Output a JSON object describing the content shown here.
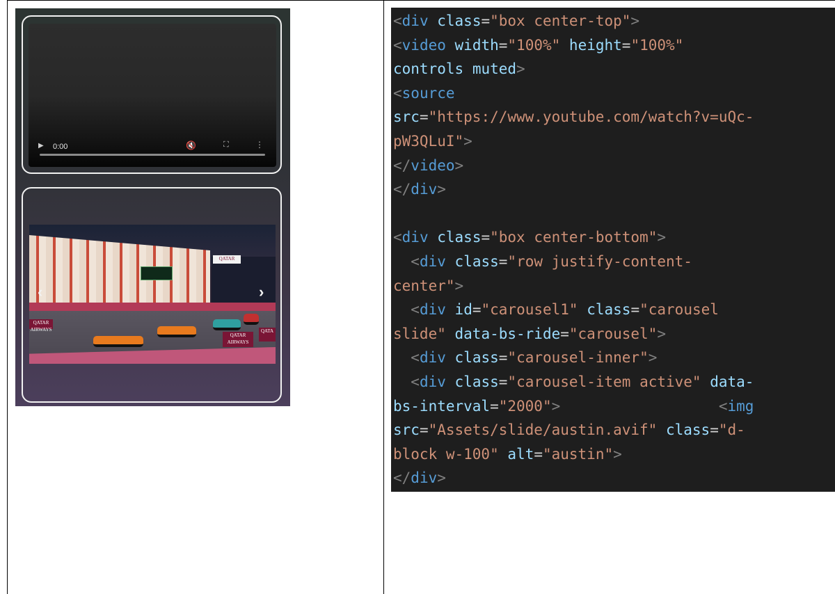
{
  "video_player": {
    "time": "0:00",
    "progress": 0,
    "icons": [
      "play-icon",
      "mute-icon",
      "fullscreen-icon",
      "more-options-icon"
    ]
  },
  "carousel": {
    "image_alt": "austin",
    "ad_texts": [
      "QATAR",
      "QATAR AIRWAYS",
      "QATAR AIRWAYS",
      "QATA"
    ],
    "prev_icon": "chevron-left-icon",
    "next_icon": "chevron-right-icon"
  },
  "code_lines": [
    [
      [
        "p",
        "<"
      ],
      [
        "t",
        "div"
      ],
      [
        "x",
        " "
      ],
      [
        "a",
        "class"
      ],
      [
        "x",
        "="
      ],
      [
        "s",
        "\"box center-top\""
      ],
      [
        "p",
        ">"
      ]
    ],
    [
      [
        "p",
        "<"
      ],
      [
        "t",
        "video"
      ],
      [
        "x",
        " "
      ],
      [
        "a",
        "width"
      ],
      [
        "x",
        "="
      ],
      [
        "s",
        "\"100%\""
      ],
      [
        "x",
        " "
      ],
      [
        "a",
        "height"
      ],
      [
        "x",
        "="
      ],
      [
        "s",
        "\"100%\""
      ]
    ],
    [
      [
        "a",
        "controls"
      ],
      [
        "x",
        " "
      ],
      [
        "a",
        "muted"
      ],
      [
        "p",
        ">"
      ]
    ],
    [
      [
        "p",
        "<"
      ],
      [
        "t",
        "source"
      ]
    ],
    [
      [
        "a",
        "src"
      ],
      [
        "x",
        "="
      ],
      [
        "s",
        "\"https://www.youtube.com/watch?v=uQc-"
      ]
    ],
    [
      [
        "s",
        "pW3QLuI\""
      ],
      [
        "p",
        ">"
      ]
    ],
    [
      [
        "p",
        "</"
      ],
      [
        "t",
        "video"
      ],
      [
        "p",
        ">"
      ]
    ],
    [
      [
        "p",
        "</"
      ],
      [
        "t",
        "div"
      ],
      [
        "p",
        ">"
      ]
    ],
    [],
    [
      [
        "p",
        "<"
      ],
      [
        "t",
        "div"
      ],
      [
        "x",
        " "
      ],
      [
        "a",
        "class"
      ],
      [
        "x",
        "="
      ],
      [
        "s",
        "\"box center-bottom\""
      ],
      [
        "p",
        ">"
      ]
    ],
    [
      [
        "x",
        "  "
      ],
      [
        "p",
        "<"
      ],
      [
        "t",
        "div"
      ],
      [
        "x",
        " "
      ],
      [
        "a",
        "class"
      ],
      [
        "x",
        "="
      ],
      [
        "s",
        "\"row justify-content-"
      ]
    ],
    [
      [
        "s",
        "center\""
      ],
      [
        "p",
        ">"
      ]
    ],
    [
      [
        "x",
        "  "
      ],
      [
        "p",
        "<"
      ],
      [
        "t",
        "div"
      ],
      [
        "x",
        " "
      ],
      [
        "a",
        "id"
      ],
      [
        "x",
        "="
      ],
      [
        "s",
        "\"carousel1\""
      ],
      [
        "x",
        " "
      ],
      [
        "a",
        "class"
      ],
      [
        "x",
        "="
      ],
      [
        "s",
        "\"carousel"
      ]
    ],
    [
      [
        "s",
        "slide\""
      ],
      [
        "x",
        " "
      ],
      [
        "a",
        "data-bs-ride"
      ],
      [
        "x",
        "="
      ],
      [
        "s",
        "\"carousel\""
      ],
      [
        "p",
        ">"
      ]
    ],
    [
      [
        "x",
        "  "
      ],
      [
        "p",
        "<"
      ],
      [
        "t",
        "div"
      ],
      [
        "x",
        " "
      ],
      [
        "a",
        "class"
      ],
      [
        "x",
        "="
      ],
      [
        "s",
        "\"carousel-inner\""
      ],
      [
        "p",
        ">"
      ]
    ],
    [
      [
        "x",
        "  "
      ],
      [
        "p",
        "<"
      ],
      [
        "t",
        "div"
      ],
      [
        "x",
        " "
      ],
      [
        "a",
        "class"
      ],
      [
        "x",
        "="
      ],
      [
        "s",
        "\"carousel-item active\""
      ],
      [
        "x",
        " "
      ],
      [
        "a",
        "data-"
      ]
    ],
    [
      [
        "a",
        "bs-interval"
      ],
      [
        "x",
        "="
      ],
      [
        "s",
        "\"2000\""
      ],
      [
        "p",
        ">"
      ],
      [
        "x",
        "                  "
      ],
      [
        "p",
        "<"
      ],
      [
        "t",
        "img"
      ]
    ],
    [
      [
        "a",
        "src"
      ],
      [
        "x",
        "="
      ],
      [
        "s",
        "\"Assets/slide/austin.avif\""
      ],
      [
        "x",
        " "
      ],
      [
        "a",
        "class"
      ],
      [
        "x",
        "="
      ],
      [
        "s",
        "\"d-"
      ]
    ],
    [
      [
        "s",
        "block w-100\""
      ],
      [
        "x",
        " "
      ],
      [
        "a",
        "alt"
      ],
      [
        "x",
        "="
      ],
      [
        "s",
        "\"austin\""
      ],
      [
        "p",
        ">"
      ]
    ],
    [
      [
        "p",
        "</"
      ],
      [
        "t",
        "div"
      ],
      [
        "p",
        ">"
      ]
    ]
  ]
}
